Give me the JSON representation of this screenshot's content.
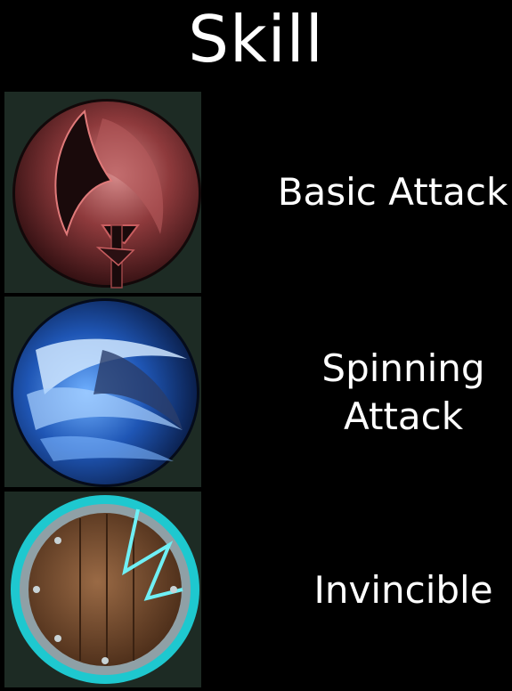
{
  "title": "Skill",
  "skills": [
    {
      "label_lines": [
        "Basic Attack"
      ],
      "icon": "axe-icon",
      "accent": "#c0393f"
    },
    {
      "label_lines": [
        "Spinning",
        "Attack"
      ],
      "icon": "spin-slash-icon",
      "accent": "#3b7fe0"
    },
    {
      "label_lines": [
        "Invincible"
      ],
      "icon": "shield-icon",
      "accent": "#2ad0d6"
    }
  ],
  "colors": {
    "background": "#000000",
    "icon_frame": "#1d2b24",
    "text": "#ffffff"
  }
}
